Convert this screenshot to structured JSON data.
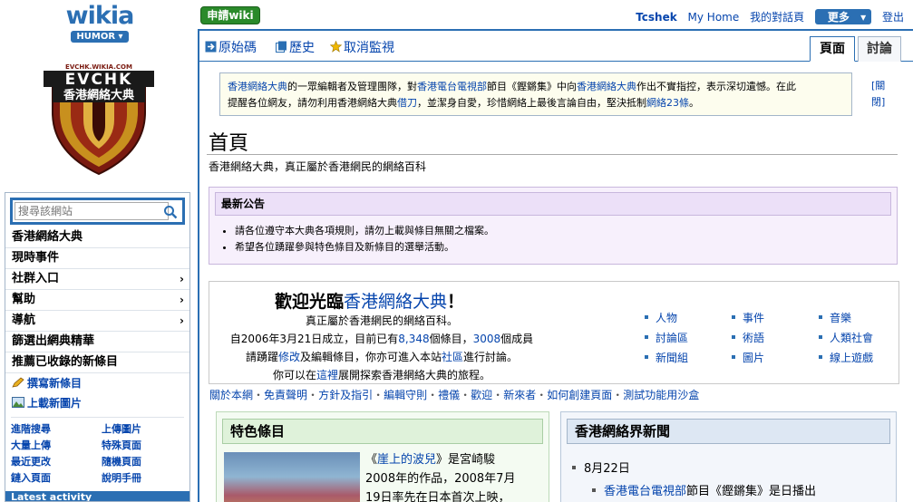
{
  "topbar": {
    "brand": "wikia",
    "hub": "HUMOR",
    "request_wiki": "申請wiki",
    "user": "Tcshek",
    "my_home": "My Home",
    "my_talk": "我的對話頁",
    "more": "更多",
    "logout": "登出"
  },
  "logo": {
    "domain": "EVCHK.WIKIA.COM",
    "name": "EVCHK",
    "subtitle": "香港網絡大典"
  },
  "sidebar": {
    "search_placeholder": "搜尋該網站",
    "nav": [
      {
        "label": "香港網絡大典"
      },
      {
        "label": "現時事件"
      },
      {
        "label": "社群入口"
      },
      {
        "label": "幫助"
      },
      {
        "label": "導航"
      },
      {
        "label": "篩選出網典精華"
      },
      {
        "label": "推薦已收錄的新條目"
      }
    ],
    "tools": [
      {
        "label": "撰寫新條目"
      },
      {
        "label": "上載新圖片"
      }
    ],
    "quick": [
      "進階搜尋",
      "上傳圖片",
      "大量上傳",
      "特殊頁面",
      "最近更改",
      "隨機頁面",
      "鏈入頁面",
      "說明手冊"
    ],
    "latest": "Latest activity"
  },
  "page": {
    "actions": [
      "原始碼",
      "歷史",
      "取消監視"
    ],
    "tabs": [
      "頁面",
      "討論"
    ],
    "notice": {
      "l1a": "香港網絡大典",
      "l1b": "的一眾編輯者及管理團隊，對",
      "l1c": "香港電台電視部",
      "l1d": "節目《鏗鏘集》中向",
      "l1e": "香港網絡大典",
      "l1f": "作出不實指控，表示深切遺憾。在此",
      "l2a": "提醒各位網友，請勿利用香港網絡大典",
      "l2b": "借刀",
      "l2c": "，並潔身自愛，珍惜網絡上最後言論自由，堅決抵制",
      "l2d": "網絡23條",
      "l2e": "。"
    },
    "close_link": "[關閉]",
    "title": "首頁",
    "tagline": "香港網絡大典，真正屬於香港網民的網絡百科",
    "announce_title": "最新公告",
    "announce_items": [
      "請各位遵守本大典各項規則，請勿上載與條目無關之檔案。",
      "希望各位踴躍參與特色條目及新條目的選舉活動。"
    ],
    "welcome": {
      "pre": "歡迎光臨",
      "name": "香港網絡大典",
      "post": "！",
      "line1": "真正屬於香港網民的網絡百科。",
      "line2a": "自2006年3月21日成立，目前已有",
      "articles": "8,348",
      "line2b": "個條目，",
      "members": "3008",
      "line2c": "個成員",
      "line3a": "請踴躍",
      "line3b": "修改",
      "line3c": "及編輯條目，你亦可進入本站",
      "line3d": "社區",
      "line3e": "進行討論。",
      "line4a": "你可以在",
      "line4b": "這裡",
      "line4c": "展開探索香港網絡大典的旅程。"
    },
    "portals": [
      "人物",
      "事件",
      "音樂",
      "討論區",
      "術語",
      "人類社會",
      "新聞組",
      "圖片",
      "線上遊戲"
    ],
    "links": [
      "關於本網",
      "免責聲明",
      "方針及指引",
      "編輯守則",
      "禮儀",
      "歡迎",
      "新來者",
      "如何創建頁面",
      "測試功能用沙盒"
    ],
    "featured": {
      "title": "特色條目",
      "t1": "《",
      "t2": "崖上的波兒",
      "t3": "》是宮崎駿",
      "t4": "2008年的作品，2008年7月",
      "t5": "19日率先在日本首次上映，"
    },
    "news": {
      "title": "香港網絡界新聞",
      "date": "8月22日",
      "item_link": "香港電台電視部",
      "item_text": "節目《鏗鏘集》是日播出"
    }
  },
  "colors": {
    "accent": "#2b6fb3",
    "link": "#0645ad",
    "request_green": "#2a8a2a"
  }
}
